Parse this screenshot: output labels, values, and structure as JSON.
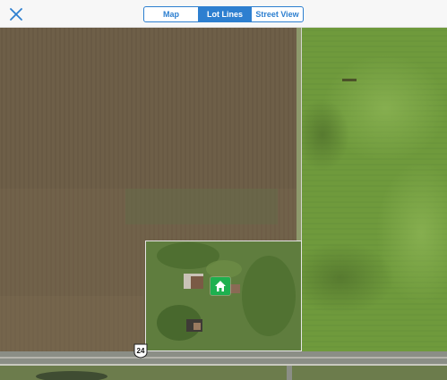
{
  "header": {
    "close": {
      "icon": "close-icon"
    },
    "view_tabs": [
      {
        "label": "Map",
        "active": false
      },
      {
        "label": "Lot Lines",
        "active": true
      },
      {
        "label": "Street View",
        "active": false
      }
    ]
  },
  "map": {
    "road_shield": {
      "label": "24"
    },
    "marker": {
      "icon": "home-icon"
    }
  },
  "colors": {
    "accent": "#2d7fd0",
    "marker": "#1eb04f",
    "lot_line": "#e6e6e6"
  }
}
